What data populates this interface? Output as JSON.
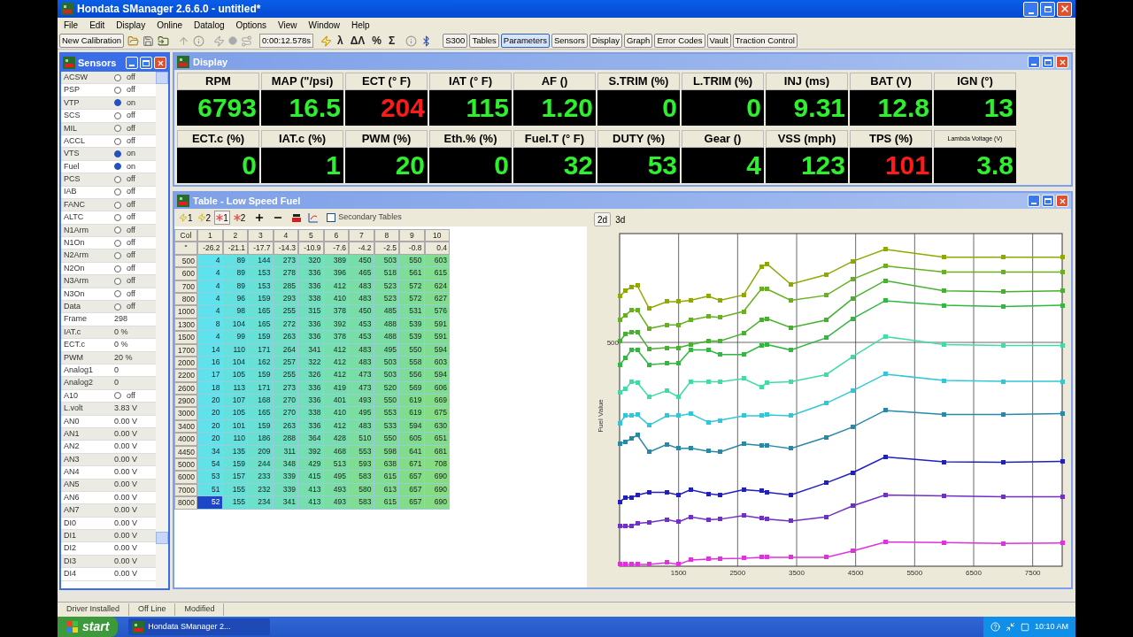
{
  "window": {
    "title": "Hondata SManager 2.6.6.0 - untitled*"
  },
  "menu": [
    "File",
    "Edit",
    "Display",
    "Online",
    "Datalog",
    "Options",
    "View",
    "Window",
    "Help"
  ],
  "toolbar": {
    "new_button": "New Calibration",
    "timer": "0:00:12.578s",
    "symbols": [
      "λ",
      "ΔΛ",
      "%",
      "Σ"
    ],
    "view_buttons": [
      {
        "label": "S300",
        "selected": false
      },
      {
        "label": "Tables",
        "selected": false
      },
      {
        "label": "Parameters",
        "selected": true
      },
      {
        "label": "Sensors",
        "selected": false
      },
      {
        "label": "Display",
        "selected": false
      },
      {
        "label": "Graph",
        "selected": false
      },
      {
        "label": "Error Codes",
        "selected": false
      },
      {
        "label": "Vault",
        "selected": false
      },
      {
        "label": "Traction Control",
        "selected": false
      }
    ]
  },
  "sensors": {
    "title": "Sensors",
    "items": [
      {
        "name": "ACSW",
        "kind": "switch",
        "on": false,
        "value": "off"
      },
      {
        "name": "PSP",
        "kind": "switch",
        "on": false,
        "value": "off"
      },
      {
        "name": "VTP",
        "kind": "switch",
        "on": true,
        "value": "on"
      },
      {
        "name": "SCS",
        "kind": "switch",
        "on": false,
        "value": "off"
      },
      {
        "name": "MIL",
        "kind": "switch",
        "on": false,
        "value": "off"
      },
      {
        "name": "ACCL",
        "kind": "switch",
        "on": false,
        "value": "off"
      },
      {
        "name": "VTS",
        "kind": "switch",
        "on": true,
        "value": "on"
      },
      {
        "name": "Fuel",
        "kind": "switch",
        "on": true,
        "value": "on"
      },
      {
        "name": "PCS",
        "kind": "switch",
        "on": false,
        "value": "off"
      },
      {
        "name": "IAB",
        "kind": "switch",
        "on": false,
        "value": "off"
      },
      {
        "name": "FANC",
        "kind": "switch",
        "on": false,
        "value": "off"
      },
      {
        "name": "ALTC",
        "kind": "switch",
        "on": false,
        "value": "off"
      },
      {
        "name": "N1Arm",
        "kind": "switch",
        "on": false,
        "value": "off"
      },
      {
        "name": "N1On",
        "kind": "switch",
        "on": false,
        "value": "off"
      },
      {
        "name": "N2Arm",
        "kind": "switch",
        "on": false,
        "value": "off"
      },
      {
        "name": "N2On",
        "kind": "switch",
        "on": false,
        "value": "off"
      },
      {
        "name": "N3Arm",
        "kind": "switch",
        "on": false,
        "value": "off"
      },
      {
        "name": "N3On",
        "kind": "switch",
        "on": false,
        "value": "off"
      },
      {
        "name": "Data",
        "kind": "switch",
        "on": false,
        "value": "off"
      },
      {
        "name": "Frame",
        "kind": "value",
        "value": "298"
      },
      {
        "name": "IAT.c",
        "kind": "value",
        "value": "0 %"
      },
      {
        "name": "ECT.c",
        "kind": "value",
        "value": "0 %"
      },
      {
        "name": "PWM",
        "kind": "value",
        "value": "20 %"
      },
      {
        "name": "Analog1",
        "kind": "value",
        "value": "0"
      },
      {
        "name": "Analog2",
        "kind": "value",
        "value": "0"
      },
      {
        "name": "A10",
        "kind": "switch",
        "on": false,
        "value": "off"
      },
      {
        "name": "L.volt",
        "kind": "value",
        "value": "3.83 V"
      },
      {
        "name": "AN0",
        "kind": "value",
        "value": "0.00 V"
      },
      {
        "name": "AN1",
        "kind": "value",
        "value": "0.00 V"
      },
      {
        "name": "AN2",
        "kind": "value",
        "value": "0.00 V"
      },
      {
        "name": "AN3",
        "kind": "value",
        "value": "0.00 V"
      },
      {
        "name": "AN4",
        "kind": "value",
        "value": "0.00 V"
      },
      {
        "name": "AN5",
        "kind": "value",
        "value": "0.00 V"
      },
      {
        "name": "AN6",
        "kind": "value",
        "value": "0.00 V"
      },
      {
        "name": "AN7",
        "kind": "value",
        "value": "0.00 V"
      },
      {
        "name": "DI0",
        "kind": "value",
        "value": "0.00 V"
      },
      {
        "name": "DI1",
        "kind": "value",
        "value": "0.00 V"
      },
      {
        "name": "DI2",
        "kind": "value",
        "value": "0.00 V"
      },
      {
        "name": "DI3",
        "kind": "value",
        "value": "0.00 V"
      },
      {
        "name": "DI4",
        "kind": "value",
        "value": "0.00 V"
      }
    ]
  },
  "display": {
    "title": "Display",
    "gauges": [
      {
        "label": "RPM",
        "value": "6793",
        "alarm": false,
        "compact": false
      },
      {
        "label": "MAP (\"/psi)",
        "value": "16.5",
        "alarm": false,
        "compact": false
      },
      {
        "label": "ECT (° F)",
        "value": "204",
        "alarm": true,
        "compact": false
      },
      {
        "label": "IAT (° F)",
        "value": "115",
        "alarm": false,
        "compact": false
      },
      {
        "label": "AF ()",
        "value": "1.20",
        "alarm": false,
        "compact": false
      },
      {
        "label": "S.TRIM (%)",
        "value": "0",
        "alarm": false,
        "compact": false
      },
      {
        "label": "L.TRIM (%)",
        "value": "0",
        "alarm": false,
        "compact": false
      },
      {
        "label": "INJ (ms)",
        "value": "9.31",
        "alarm": false,
        "compact": false
      },
      {
        "label": "BAT (V)",
        "value": "12.8",
        "alarm": false,
        "compact": false
      },
      {
        "label": "IGN (°)",
        "value": "13",
        "alarm": false,
        "compact": false
      },
      {
        "label": "ECT.c (%)",
        "value": "0",
        "alarm": false,
        "compact": false
      },
      {
        "label": "IAT.c (%)",
        "value": "1",
        "alarm": false,
        "compact": false
      },
      {
        "label": "PWM (%)",
        "value": "20",
        "alarm": false,
        "compact": false
      },
      {
        "label": "Eth.% (%)",
        "value": "0",
        "alarm": false,
        "compact": false
      },
      {
        "label": "Fuel.T (° F)",
        "value": "32",
        "alarm": false,
        "compact": false
      },
      {
        "label": "DUTY (%)",
        "value": "53",
        "alarm": false,
        "compact": false
      },
      {
        "label": "Gear ()",
        "value": "4",
        "alarm": false,
        "compact": false
      },
      {
        "label": "VSS (mph)",
        "value": "123",
        "alarm": false,
        "compact": false
      },
      {
        "label": "TPS (%)",
        "value": "101",
        "alarm": true,
        "compact": false
      },
      {
        "label": "Lambda Voltage (V)",
        "value": "3.8",
        "alarm": false,
        "compact": true
      }
    ]
  },
  "table": {
    "title": "Table - Low Speed Fuel",
    "tools": [
      {
        "label": "1",
        "kind": "bolt",
        "selected": false
      },
      {
        "label": "2",
        "kind": "bolt",
        "selected": false
      },
      {
        "label": "1",
        "kind": "star",
        "selected": true
      },
      {
        "label": "2",
        "kind": "star",
        "selected": false
      }
    ],
    "secondary": {
      "label": "Secondary Tables",
      "checked": false
    },
    "corner": "Col",
    "load_label": "\"",
    "columns": [
      {
        "label": "1",
        "load": "-26.2",
        "color": "#e030e0"
      },
      {
        "label": "2",
        "load": "-21.1",
        "color": "#7030c8"
      },
      {
        "label": "3",
        "load": "-17.7",
        "color": "#2020c0"
      },
      {
        "label": "4",
        "load": "-14.3",
        "color": "#2888a8"
      },
      {
        "label": "5",
        "load": "-10.9",
        "color": "#30c8d8"
      },
      {
        "label": "6",
        "load": "-7.6",
        "color": "#40dca8"
      },
      {
        "label": "7",
        "load": "-4.2",
        "color": "#30b840"
      },
      {
        "label": "8",
        "load": "-2.5",
        "color": "#48b030"
      },
      {
        "label": "9",
        "load": "-0.8",
        "color": "#68b020"
      },
      {
        "label": "10",
        "load": "0.4",
        "color": "#90a800"
      }
    ],
    "rows": [
      {
        "rpm": "500",
        "cells": [
          {
            "v": "4",
            "selected": false
          },
          {
            "v": "89",
            "selected": false
          },
          {
            "v": "144",
            "selected": false
          },
          {
            "v": "273",
            "selected": false
          },
          {
            "v": "320",
            "selected": false
          },
          {
            "v": "389",
            "selected": false
          },
          {
            "v": "450",
            "selected": false
          },
          {
            "v": "503",
            "selected": false
          },
          {
            "v": "550",
            "selected": false
          },
          {
            "v": "603",
            "selected": false
          }
        ]
      },
      {
        "rpm": "600",
        "cells": [
          {
            "v": "4",
            "selected": false
          },
          {
            "v": "89",
            "selected": false
          },
          {
            "v": "153",
            "selected": false
          },
          {
            "v": "278",
            "selected": false
          },
          {
            "v": "336",
            "selected": false
          },
          {
            "v": "396",
            "selected": false
          },
          {
            "v": "465",
            "selected": false
          },
          {
            "v": "518",
            "selected": false
          },
          {
            "v": "561",
            "selected": false
          },
          {
            "v": "615",
            "selected": false
          }
        ]
      },
      {
        "rpm": "700",
        "cells": [
          {
            "v": "4",
            "selected": false
          },
          {
            "v": "89",
            "selected": false
          },
          {
            "v": "153",
            "selected": false
          },
          {
            "v": "285",
            "selected": false
          },
          {
            "v": "336",
            "selected": false
          },
          {
            "v": "412",
            "selected": false
          },
          {
            "v": "483",
            "selected": false
          },
          {
            "v": "523",
            "selected": false
          },
          {
            "v": "572",
            "selected": false
          },
          {
            "v": "624",
            "selected": false
          }
        ]
      },
      {
        "rpm": "800",
        "cells": [
          {
            "v": "4",
            "selected": false
          },
          {
            "v": "96",
            "selected": false
          },
          {
            "v": "159",
            "selected": false
          },
          {
            "v": "293",
            "selected": false
          },
          {
            "v": "338",
            "selected": false
          },
          {
            "v": "410",
            "selected": false
          },
          {
            "v": "483",
            "selected": false
          },
          {
            "v": "523",
            "selected": false
          },
          {
            "v": "572",
            "selected": false
          },
          {
            "v": "627",
            "selected": false
          }
        ]
      },
      {
        "rpm": "1000",
        "cells": [
          {
            "v": "4",
            "selected": false
          },
          {
            "v": "98",
            "selected": false
          },
          {
            "v": "165",
            "selected": false
          },
          {
            "v": "255",
            "selected": false
          },
          {
            "v": "315",
            "selected": false
          },
          {
            "v": "378",
            "selected": false
          },
          {
            "v": "450",
            "selected": false
          },
          {
            "v": "485",
            "selected": false
          },
          {
            "v": "531",
            "selected": false
          },
          {
            "v": "576",
            "selected": false
          }
        ]
      },
      {
        "rpm": "1300",
        "cells": [
          {
            "v": "8",
            "selected": false
          },
          {
            "v": "104",
            "selected": false
          },
          {
            "v": "165",
            "selected": false
          },
          {
            "v": "272",
            "selected": false
          },
          {
            "v": "336",
            "selected": false
          },
          {
            "v": "392",
            "selected": false
          },
          {
            "v": "453",
            "selected": false
          },
          {
            "v": "488",
            "selected": false
          },
          {
            "v": "539",
            "selected": false
          },
          {
            "v": "591",
            "selected": false
          }
        ]
      },
      {
        "rpm": "1500",
        "cells": [
          {
            "v": "4",
            "selected": false
          },
          {
            "v": "99",
            "selected": false
          },
          {
            "v": "159",
            "selected": false
          },
          {
            "v": "263",
            "selected": false
          },
          {
            "v": "336",
            "selected": false
          },
          {
            "v": "378",
            "selected": false
          },
          {
            "v": "453",
            "selected": false
          },
          {
            "v": "488",
            "selected": false
          },
          {
            "v": "539",
            "selected": false
          },
          {
            "v": "591",
            "selected": false
          }
        ]
      },
      {
        "rpm": "1700",
        "cells": [
          {
            "v": "14",
            "selected": false
          },
          {
            "v": "110",
            "selected": false
          },
          {
            "v": "171",
            "selected": false
          },
          {
            "v": "264",
            "selected": false
          },
          {
            "v": "341",
            "selected": false
          },
          {
            "v": "412",
            "selected": false
          },
          {
            "v": "483",
            "selected": false
          },
          {
            "v": "495",
            "selected": false
          },
          {
            "v": "550",
            "selected": false
          },
          {
            "v": "594",
            "selected": false
          }
        ]
      },
      {
        "rpm": "2000",
        "cells": [
          {
            "v": "16",
            "selected": false
          },
          {
            "v": "104",
            "selected": false
          },
          {
            "v": "162",
            "selected": false
          },
          {
            "v": "257",
            "selected": false
          },
          {
            "v": "322",
            "selected": false
          },
          {
            "v": "412",
            "selected": false
          },
          {
            "v": "483",
            "selected": false
          },
          {
            "v": "503",
            "selected": false
          },
          {
            "v": "558",
            "selected": false
          },
          {
            "v": "603",
            "selected": false
          }
        ]
      },
      {
        "rpm": "2200",
        "cells": [
          {
            "v": "17",
            "selected": false
          },
          {
            "v": "105",
            "selected": false
          },
          {
            "v": "159",
            "selected": false
          },
          {
            "v": "255",
            "selected": false
          },
          {
            "v": "326",
            "selected": false
          },
          {
            "v": "412",
            "selected": false
          },
          {
            "v": "473",
            "selected": false
          },
          {
            "v": "503",
            "selected": false
          },
          {
            "v": "556",
            "selected": false
          },
          {
            "v": "594",
            "selected": false
          }
        ]
      },
      {
        "rpm": "2600",
        "cells": [
          {
            "v": "18",
            "selected": false
          },
          {
            "v": "113",
            "selected": false
          },
          {
            "v": "171",
            "selected": false
          },
          {
            "v": "273",
            "selected": false
          },
          {
            "v": "336",
            "selected": false
          },
          {
            "v": "419",
            "selected": false
          },
          {
            "v": "473",
            "selected": false
          },
          {
            "v": "520",
            "selected": false
          },
          {
            "v": "569",
            "selected": false
          },
          {
            "v": "606",
            "selected": false
          }
        ]
      },
      {
        "rpm": "2900",
        "cells": [
          {
            "v": "20",
            "selected": false
          },
          {
            "v": "107",
            "selected": false
          },
          {
            "v": "168",
            "selected": false
          },
          {
            "v": "270",
            "selected": false
          },
          {
            "v": "336",
            "selected": false
          },
          {
            "v": "401",
            "selected": false
          },
          {
            "v": "493",
            "selected": false
          },
          {
            "v": "550",
            "selected": false
          },
          {
            "v": "619",
            "selected": false
          },
          {
            "v": "669",
            "selected": false
          }
        ]
      },
      {
        "rpm": "3000",
        "cells": [
          {
            "v": "20",
            "selected": false
          },
          {
            "v": "105",
            "selected": false
          },
          {
            "v": "165",
            "selected": false
          },
          {
            "v": "270",
            "selected": false
          },
          {
            "v": "338",
            "selected": false
          },
          {
            "v": "410",
            "selected": false
          },
          {
            "v": "495",
            "selected": false
          },
          {
            "v": "553",
            "selected": false
          },
          {
            "v": "619",
            "selected": false
          },
          {
            "v": "675",
            "selected": false
          }
        ]
      },
      {
        "rpm": "3400",
        "cells": [
          {
            "v": "20",
            "selected": false
          },
          {
            "v": "101",
            "selected": false
          },
          {
            "v": "159",
            "selected": false
          },
          {
            "v": "263",
            "selected": false
          },
          {
            "v": "336",
            "selected": false
          },
          {
            "v": "412",
            "selected": false
          },
          {
            "v": "483",
            "selected": false
          },
          {
            "v": "533",
            "selected": false
          },
          {
            "v": "594",
            "selected": false
          },
          {
            "v": "630",
            "selected": false
          }
        ]
      },
      {
        "rpm": "4000",
        "cells": [
          {
            "v": "20",
            "selected": false
          },
          {
            "v": "110",
            "selected": false
          },
          {
            "v": "186",
            "selected": false
          },
          {
            "v": "288",
            "selected": false
          },
          {
            "v": "364",
            "selected": false
          },
          {
            "v": "428",
            "selected": false
          },
          {
            "v": "510",
            "selected": false
          },
          {
            "v": "550",
            "selected": false
          },
          {
            "v": "605",
            "selected": false
          },
          {
            "v": "651",
            "selected": false
          }
        ]
      },
      {
        "rpm": "4450",
        "cells": [
          {
            "v": "34",
            "selected": false
          },
          {
            "v": "135",
            "selected": false
          },
          {
            "v": "209",
            "selected": false
          },
          {
            "v": "311",
            "selected": false
          },
          {
            "v": "392",
            "selected": false
          },
          {
            "v": "468",
            "selected": false
          },
          {
            "v": "553",
            "selected": false
          },
          {
            "v": "598",
            "selected": false
          },
          {
            "v": "641",
            "selected": false
          },
          {
            "v": "681",
            "selected": false
          }
        ]
      },
      {
        "rpm": "5000",
        "cells": [
          {
            "v": "54",
            "selected": false
          },
          {
            "v": "159",
            "selected": false
          },
          {
            "v": "244",
            "selected": false
          },
          {
            "v": "348",
            "selected": false
          },
          {
            "v": "429",
            "selected": false
          },
          {
            "v": "513",
            "selected": false
          },
          {
            "v": "593",
            "selected": false
          },
          {
            "v": "638",
            "selected": false
          },
          {
            "v": "671",
            "selected": false
          },
          {
            "v": "708",
            "selected": false
          }
        ]
      },
      {
        "rpm": "6000",
        "cells": [
          {
            "v": "53",
            "selected": false
          },
          {
            "v": "157",
            "selected": false
          },
          {
            "v": "233",
            "selected": false
          },
          {
            "v": "339",
            "selected": false
          },
          {
            "v": "415",
            "selected": false
          },
          {
            "v": "495",
            "selected": false
          },
          {
            "v": "583",
            "selected": false
          },
          {
            "v": "615",
            "selected": false
          },
          {
            "v": "657",
            "selected": false
          },
          {
            "v": "690",
            "selected": false
          }
        ]
      },
      {
        "rpm": "7000",
        "cells": [
          {
            "v": "51",
            "selected": false
          },
          {
            "v": "155",
            "selected": false
          },
          {
            "v": "232",
            "selected": false
          },
          {
            "v": "339",
            "selected": false
          },
          {
            "v": "413",
            "selected": false
          },
          {
            "v": "493",
            "selected": false
          },
          {
            "v": "580",
            "selected": false
          },
          {
            "v": "613",
            "selected": false
          },
          {
            "v": "657",
            "selected": false
          },
          {
            "v": "690",
            "selected": false
          }
        ]
      },
      {
        "rpm": "8000",
        "cells": [
          {
            "v": "52",
            "selected": true
          },
          {
            "v": "155",
            "selected": false
          },
          {
            "v": "234",
            "selected": false
          },
          {
            "v": "341",
            "selected": false
          },
          {
            "v": "413",
            "selected": false
          },
          {
            "v": "493",
            "selected": false
          },
          {
            "v": "583",
            "selected": false
          },
          {
            "v": "615",
            "selected": false
          },
          {
            "v": "657",
            "selected": false
          },
          {
            "v": "690",
            "selected": false
          }
        ]
      }
    ],
    "views": [
      {
        "label": "2d",
        "selected": true
      },
      {
        "label": "3d",
        "selected": false
      }
    ],
    "graph": {
      "ylabel": "Fuel Value",
      "ytick": "500",
      "xticks": [
        "1500",
        "2500",
        "3500",
        "4500",
        "5500",
        "6500",
        "7500"
      ]
    }
  },
  "status_bar": [
    "Driver Installed",
    "Off Line",
    "Modified"
  ],
  "taskbar": {
    "start": "start",
    "task": "Hondata SManager 2...",
    "clock": "10:10 AM"
  }
}
